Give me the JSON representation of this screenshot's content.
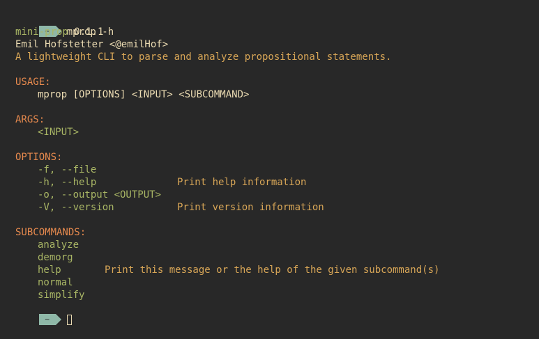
{
  "prompt": {
    "symbol": "~",
    "command": "mprop -h"
  },
  "header": {
    "name": "mini-prop",
    "version": "0.1.1",
    "author": "Emil Hofstetter <@emilHof>",
    "description": "A lightweight CLI to parse and analyze propositional statements."
  },
  "usage": {
    "heading": "USAGE:",
    "text": "mprop [OPTIONS] <INPUT> <SUBCOMMAND>"
  },
  "args": {
    "heading": "ARGS:",
    "items": [
      "<INPUT>"
    ]
  },
  "options": {
    "heading": "OPTIONS:",
    "items": [
      {
        "flag": "-f, --file",
        "desc": ""
      },
      {
        "flag": "-h, --help",
        "desc": "Print help information"
      },
      {
        "flag": "-o, --output <OUTPUT>",
        "desc": ""
      },
      {
        "flag": "-V, --version",
        "desc": "Print version information"
      }
    ]
  },
  "subcommands": {
    "heading": "SUBCOMMANDS:",
    "items": [
      {
        "name": "analyze",
        "desc": ""
      },
      {
        "name": "demorg",
        "desc": ""
      },
      {
        "name": "help",
        "desc": "Print this message or the help of the given subcommand(s)"
      },
      {
        "name": "normal",
        "desc": ""
      },
      {
        "name": "simplify",
        "desc": ""
      }
    ]
  },
  "colors": {
    "background": "#282828",
    "prompt_badge": "#8fb8a8",
    "heading": "#e78a4e",
    "item": "#a9b665",
    "text": "#ebdbb2"
  }
}
